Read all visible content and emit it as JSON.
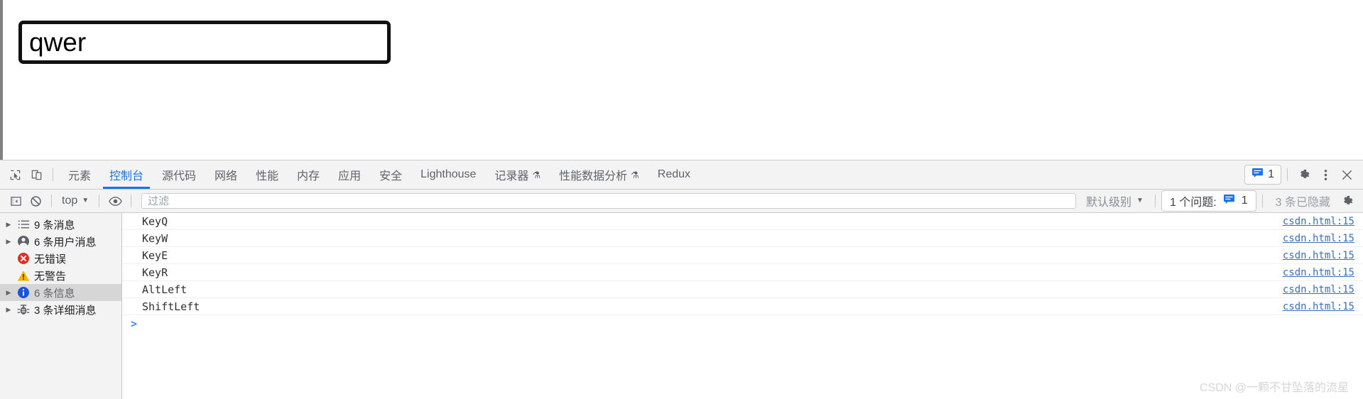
{
  "page": {
    "text_input_value": "qwer",
    "text_input_placeholder": ""
  },
  "devtools": {
    "tabstrip": {
      "inspect_icon": "inspect-cursor-icon",
      "device_icon": "device-toolbar-icon",
      "tabs": [
        {
          "label": "元素",
          "active": false,
          "flask": ""
        },
        {
          "label": "控制台",
          "active": true,
          "flask": ""
        },
        {
          "label": "源代码",
          "active": false,
          "flask": ""
        },
        {
          "label": "网络",
          "active": false,
          "flask": ""
        },
        {
          "label": "性能",
          "active": false,
          "flask": ""
        },
        {
          "label": "内存",
          "active": false,
          "flask": ""
        },
        {
          "label": "应用",
          "active": false,
          "flask": ""
        },
        {
          "label": "安全",
          "active": false,
          "flask": ""
        },
        {
          "label": "Lighthouse",
          "active": false,
          "flask": ""
        },
        {
          "label": "记录器",
          "active": false,
          "flask": "⚗"
        },
        {
          "label": "性能数据分析",
          "active": false,
          "flask": "⚗"
        },
        {
          "label": "Redux",
          "active": false,
          "flask": ""
        }
      ],
      "issues_count": "1",
      "settings_icon": "gear-icon",
      "more_icon": "more-vertical-icon",
      "close_icon": "close-icon"
    },
    "console_toolbar": {
      "sidebar_toggle_icon": "show-console-sidebar-icon",
      "clear_icon": "clear-console-icon",
      "context": "top",
      "eye_icon": "live-expression-icon",
      "filter_placeholder": "过滤",
      "filter_value": "",
      "level": "默认级别",
      "issues_label": "1 个问题:",
      "issues_count": "1",
      "hidden_label": "3 条已隐藏",
      "settings_icon": "gear-icon"
    },
    "sidebar": {
      "items": [
        {
          "label": "9 条消息",
          "icon": "list-icon",
          "expandable": true,
          "selected": false
        },
        {
          "label": "6 条用户消息",
          "icon": "user-icon",
          "expandable": true,
          "selected": false
        },
        {
          "label": "无错误",
          "icon": "error-icon",
          "expandable": false,
          "selected": false
        },
        {
          "label": "无警告",
          "icon": "warning-icon",
          "expandable": false,
          "selected": false
        },
        {
          "label": "6 条信息",
          "icon": "info-icon",
          "expandable": true,
          "selected": true
        },
        {
          "label": "3 条详细消息",
          "icon": "verbose-bug-icon",
          "expandable": true,
          "selected": false
        }
      ]
    },
    "messages": [
      {
        "text": "KeyQ",
        "source": "csdn.html:15"
      },
      {
        "text": "KeyW",
        "source": "csdn.html:15"
      },
      {
        "text": "KeyE",
        "source": "csdn.html:15"
      },
      {
        "text": "KeyR",
        "source": "csdn.html:15"
      },
      {
        "text": "AltLeft",
        "source": "csdn.html:15"
      },
      {
        "text": "ShiftLeft",
        "source": "csdn.html:15"
      }
    ],
    "prompt_symbol": ">"
  },
  "watermark": "CSDN @一颗不甘坠落的流星",
  "colors": {
    "accent_blue": "#1a73e8",
    "link_blue": "#3a6fbb",
    "error_red": "#d93025",
    "warning_yellow": "#f5b400",
    "info_blue": "#1a73e8",
    "toolbar_bg": "#f3f3f3",
    "selected_row": "#d6d6d6"
  }
}
